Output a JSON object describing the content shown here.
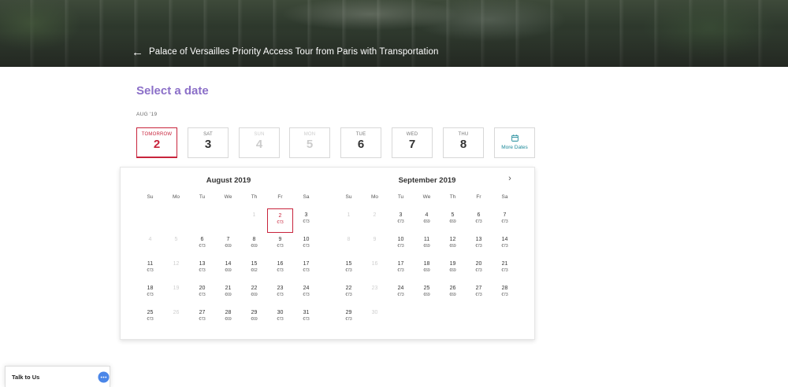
{
  "header": {
    "back_icon": "arrow-left-icon",
    "title": "Palace of Versailles Priority Access Tour from Paris with Transportation"
  },
  "select_date": {
    "title": "Select a date",
    "month_label": "AUG '19"
  },
  "date_cards": [
    {
      "dow": "TOMORROW",
      "num": "2",
      "state": "selected"
    },
    {
      "dow": "SAT",
      "num": "3",
      "state": "available"
    },
    {
      "dow": "SUN",
      "num": "4",
      "state": "disabled"
    },
    {
      "dow": "MON",
      "num": "5",
      "state": "disabled"
    },
    {
      "dow": "TUE",
      "num": "6",
      "state": "available"
    },
    {
      "dow": "WED",
      "num": "7",
      "state": "available"
    },
    {
      "dow": "THU",
      "num": "8",
      "state": "available"
    }
  ],
  "more_dates": {
    "label": "More Dates",
    "icon": "calendar-icon"
  },
  "calendar": {
    "weekdays": [
      "Su",
      "Mo",
      "Tu",
      "We",
      "Th",
      "Fr",
      "Sa"
    ],
    "next_icon": "chevron-right-icon",
    "months": [
      {
        "title": "August 2019",
        "weeks": [
          [
            null,
            null,
            null,
            null,
            {
              "d": "1",
              "p": "",
              "past": true
            },
            {
              "d": "2",
              "p": "€73",
              "sel": true
            },
            {
              "d": "3",
              "p": "€73"
            }
          ],
          [
            {
              "d": "4",
              "p": "",
              "past": true
            },
            {
              "d": "5",
              "p": "",
              "past": true
            },
            {
              "d": "6",
              "p": "€73"
            },
            {
              "d": "7",
              "p": "€69"
            },
            {
              "d": "8",
              "p": "€69"
            },
            {
              "d": "9",
              "p": "€73"
            },
            {
              "d": "10",
              "p": "€73"
            }
          ],
          [
            {
              "d": "11",
              "p": "€73"
            },
            {
              "d": "12",
              "p": "",
              "past": true
            },
            {
              "d": "13",
              "p": "€73"
            },
            {
              "d": "14",
              "p": "€69"
            },
            {
              "d": "15",
              "p": "€62"
            },
            {
              "d": "16",
              "p": "€73"
            },
            {
              "d": "17",
              "p": "€73"
            }
          ],
          [
            {
              "d": "18",
              "p": "€73"
            },
            {
              "d": "19",
              "p": "",
              "past": true
            },
            {
              "d": "20",
              "p": "€73"
            },
            {
              "d": "21",
              "p": "€69"
            },
            {
              "d": "22",
              "p": "€69"
            },
            {
              "d": "23",
              "p": "€73"
            },
            {
              "d": "24",
              "p": "€73"
            }
          ],
          [
            {
              "d": "25",
              "p": "€73"
            },
            {
              "d": "26",
              "p": "",
              "past": true
            },
            {
              "d": "27",
              "p": "€73"
            },
            {
              "d": "28",
              "p": "€69"
            },
            {
              "d": "29",
              "p": "€69"
            },
            {
              "d": "30",
              "p": "€73"
            },
            {
              "d": "31",
              "p": "€73"
            }
          ]
        ]
      },
      {
        "title": "September 2019",
        "weeks": [
          [
            {
              "d": "1",
              "p": "",
              "past": true
            },
            {
              "d": "2",
              "p": "",
              "past": true
            },
            {
              "d": "3",
              "p": "€73"
            },
            {
              "d": "4",
              "p": "€69"
            },
            {
              "d": "5",
              "p": "€69"
            },
            {
              "d": "6",
              "p": "€73"
            },
            {
              "d": "7",
              "p": "€73"
            }
          ],
          [
            {
              "d": "8",
              "p": "",
              "past": true
            },
            {
              "d": "9",
              "p": "",
              "past": true
            },
            {
              "d": "10",
              "p": "€73"
            },
            {
              "d": "11",
              "p": "€69"
            },
            {
              "d": "12",
              "p": "€69"
            },
            {
              "d": "13",
              "p": "€73"
            },
            {
              "d": "14",
              "p": "€73"
            }
          ],
          [
            {
              "d": "15",
              "p": "€73"
            },
            {
              "d": "16",
              "p": "",
              "past": true
            },
            {
              "d": "17",
              "p": "€73"
            },
            {
              "d": "18",
              "p": "€69"
            },
            {
              "d": "19",
              "p": "€69"
            },
            {
              "d": "20",
              "p": "€73"
            },
            {
              "d": "21",
              "p": "€73"
            }
          ],
          [
            {
              "d": "22",
              "p": "€73"
            },
            {
              "d": "23",
              "p": "",
              "past": true
            },
            {
              "d": "24",
              "p": "€73"
            },
            {
              "d": "25",
              "p": "€69"
            },
            {
              "d": "26",
              "p": "€69"
            },
            {
              "d": "27",
              "p": "€73"
            },
            {
              "d": "28",
              "p": "€73"
            }
          ],
          [
            {
              "d": "29",
              "p": "€73"
            },
            {
              "d": "30",
              "p": "",
              "past": true
            },
            null,
            null,
            null,
            null,
            null
          ]
        ]
      }
    ]
  },
  "chat": {
    "label": "Talk to Us",
    "icon": "chat-bubble-icon",
    "accent": "#4a86e8"
  },
  "colors": {
    "accent_purple": "#8b6fc8",
    "selected_red": "#c8243c",
    "link_teal": "#1e8a9a"
  }
}
